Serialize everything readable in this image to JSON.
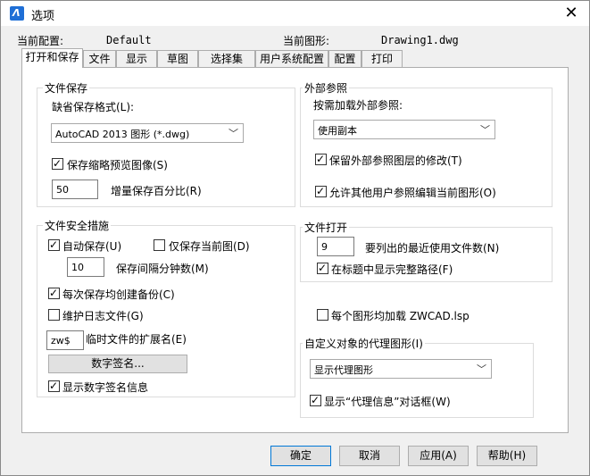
{
  "window": {
    "title": "选项",
    "close_glyph": "✕"
  },
  "header": {
    "current_profile_label": "当前配置:",
    "current_profile_value": "Default",
    "current_drawing_label": "当前图形:",
    "current_drawing_value": "Drawing1.dwg"
  },
  "tabs": [
    "打开和保存",
    "文件",
    "显示",
    "草图",
    "选择集",
    "用户系统配置",
    "配置",
    "打印"
  ],
  "file_save": {
    "title": "文件保存",
    "default_format_label": "缺省保存格式(L):",
    "default_format_value": "AutoCAD 2013 图形 (*.dwg)",
    "save_thumbnail_label": "保存缩略预览图像(S)",
    "save_thumbnail_checked": true,
    "incremental_value": "50",
    "incremental_label": "增量保存百分比(R)"
  },
  "file_safety": {
    "title": "文件安全措施",
    "autosave_label": "自动保存(U)",
    "autosave_checked": true,
    "save_current_only_label": "仅保存当前图(D)",
    "save_current_only_checked": false,
    "interval_value": "10",
    "interval_label": "保存间隔分钟数(M)",
    "backup_label": "每次保存均创建备份(C)",
    "backup_checked": true,
    "log_label": "维护日志文件(G)",
    "log_checked": false,
    "temp_ext_value": "zw$",
    "temp_ext_label": "临时文件的扩展名(E)",
    "digital_sig_button": "数字签名...",
    "show_sig_label": "显示数字签名信息",
    "show_sig_checked": true
  },
  "xref": {
    "title": "外部参照",
    "demand_load_label": "按需加载外部参照:",
    "demand_load_value": "使用副本",
    "retain_changes_label": "保留外部参照图层的修改(T)",
    "retain_changes_checked": true,
    "allow_edit_label": "允许其他用户参照编辑当前图形(O)",
    "allow_edit_checked": true
  },
  "file_open": {
    "title": "文件打开",
    "recent_count_value": "9",
    "recent_count_label": "要列出的最近使用文件数(N)",
    "full_path_label": "在标题中显示完整路径(F)",
    "full_path_checked": true
  },
  "zwcad_lsp": {
    "label": "每个图形均加载 ZWCAD.lsp",
    "checked": false
  },
  "proxy": {
    "title": "自定义对象的代理图形(I)",
    "value": "显示代理图形",
    "show_dialog_label": "显示“代理信息”对话框(W)",
    "show_dialog_checked": true
  },
  "buttons": {
    "ok": "确定",
    "cancel": "取消",
    "apply": "应用(A)",
    "help": "帮助(H)"
  }
}
